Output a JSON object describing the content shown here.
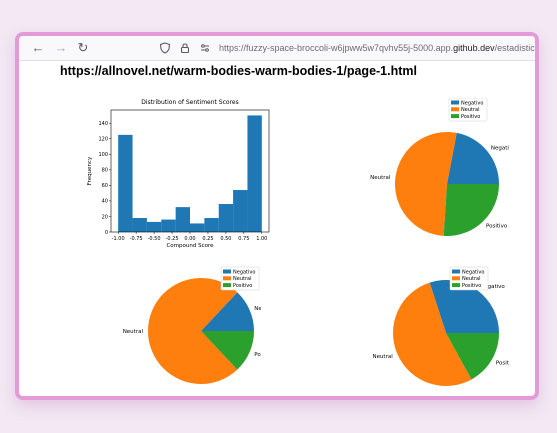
{
  "browser": {
    "url_rest": "https://fuzzy-space-broccoli-w6jpww5w7qvhv55j-5000.app.",
    "url_host": "github.dev",
    "url_path": "/estadistica",
    "icons": [
      "back-icon",
      "forward-icon",
      "reload-icon",
      "shield-icon",
      "lock-icon",
      "permissions-icon"
    ]
  },
  "page": {
    "heading": "https://allnovel.net/warm-bodies-warm-bodies-1/page-1.html"
  },
  "colors": {
    "blue": "#1f77b4",
    "orange": "#ff7f0e",
    "green": "#2ca02c",
    "frame": "#e39ad8"
  },
  "chart_data": [
    {
      "type": "bar",
      "title": "Distribution of Sentiment Scores",
      "xlabel": "Compound Score",
      "ylabel": "Frequency",
      "bin_edges": [
        -1.0,
        -0.8,
        -0.6,
        -0.4,
        -0.2,
        0.0,
        0.2,
        0.4,
        0.6,
        0.8,
        1.0
      ],
      "values": [
        125,
        18,
        13,
        16,
        32,
        11,
        18,
        36,
        54,
        150
      ],
      "xticks": [
        "-1.00",
        "-0.75",
        "-0.50",
        "-0.25",
        "0.00",
        "0.25",
        "0.50",
        "0.75",
        "1.00"
      ],
      "xtick_values": [
        -1.0,
        -0.75,
        -0.5,
        -0.25,
        0.0,
        0.25,
        0.5,
        0.75,
        1.0
      ],
      "yticks": [
        "0",
        "20",
        "40",
        "60",
        "80",
        "100",
        "120",
        "140"
      ],
      "ytick_values": [
        0,
        20,
        40,
        60,
        80,
        100,
        120,
        140
      ],
      "xlim": [
        -1.1,
        1.1
      ],
      "ylim": [
        0,
        157
      ],
      "color": "#1f77b4"
    },
    {
      "type": "pie",
      "labels": [
        "Negativo",
        "Neutral",
        "Positivo"
      ],
      "values": [
        22,
        52,
        26
      ],
      "colors": [
        "#1f77b4",
        "#ff7f0e",
        "#2ca02c"
      ],
      "legend": "top-right"
    },
    {
      "type": "pie",
      "labels": [
        "Negativo",
        "Neutral",
        "Positivo"
      ],
      "values": [
        13,
        74,
        13
      ],
      "colors": [
        "#1f77b4",
        "#ff7f0e",
        "#2ca02c"
      ],
      "legend": "top-right"
    },
    {
      "type": "pie",
      "labels": [
        "Negativo",
        "Neutral",
        "Positivo"
      ],
      "values": [
        30,
        53,
        17
      ],
      "colors": [
        "#1f77b4",
        "#ff7f0e",
        "#2ca02c"
      ],
      "legend": "top-right"
    }
  ]
}
